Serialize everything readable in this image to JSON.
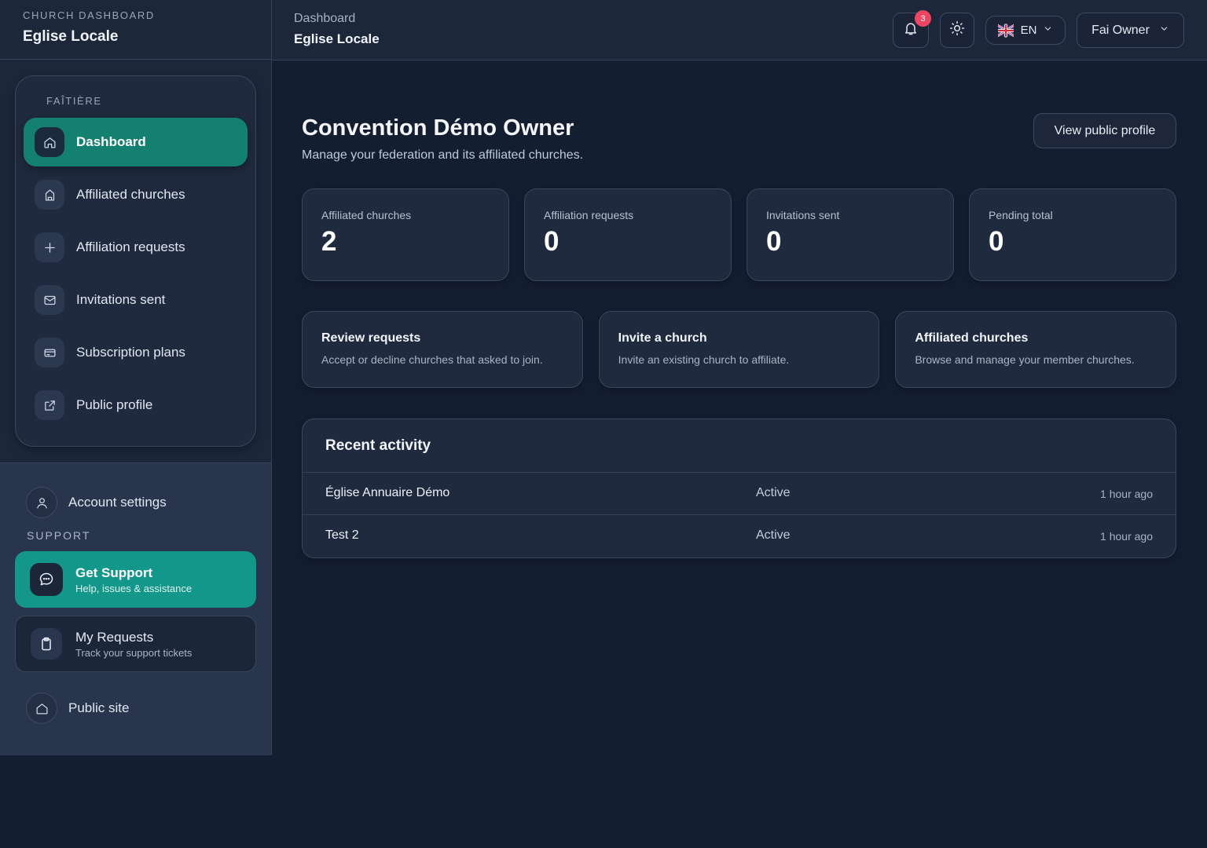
{
  "brand": {
    "kicker": "CHURCH DASHBOARD",
    "title": "Eglise Locale"
  },
  "nav": {
    "section": "FAÎTIÈRE",
    "items": [
      {
        "label": "Dashboard",
        "icon": "home-icon",
        "active": true
      },
      {
        "label": "Affiliated churches",
        "icon": "church-icon"
      },
      {
        "label": "Affiliation requests",
        "icon": "plus-icon"
      },
      {
        "label": "Invitations sent",
        "icon": "mail-icon"
      },
      {
        "label": "Subscription plans",
        "icon": "credit-card-icon"
      },
      {
        "label": "Public profile",
        "icon": "external-link-icon"
      }
    ]
  },
  "account": {
    "label": "Account settings",
    "icon": "user-icon"
  },
  "support": {
    "label": "SUPPORT",
    "get_support": {
      "title": "Get Support",
      "subtitle": "Help, issues & assistance",
      "icon": "chat-icon"
    },
    "my_requests": {
      "title": "My Requests",
      "subtitle": "Track your support tickets",
      "icon": "clipboard-icon"
    }
  },
  "public_site": {
    "label": "Public site",
    "icon": "home-icon"
  },
  "topbar": {
    "breadcrumb": "Dashboard",
    "subtitle": "Eglise Locale",
    "notifications_count": "3",
    "language": "EN",
    "user": "Fai Owner"
  },
  "page": {
    "title": "Convention Démo Owner",
    "subtitle": "Manage your federation and its affiliated churches.",
    "public_profile_button": "View public profile"
  },
  "stats": [
    {
      "label": "Affiliated churches",
      "value": "2"
    },
    {
      "label": "Affiliation requests",
      "value": "0"
    },
    {
      "label": "Invitations sent",
      "value": "0"
    },
    {
      "label": "Pending total",
      "value": "0"
    }
  ],
  "actions": [
    {
      "title": "Review requests",
      "desc": "Accept or decline churches that asked to join."
    },
    {
      "title": "Invite a church",
      "desc": "Invite an existing church to affiliate."
    },
    {
      "title": "Affiliated churches",
      "desc": "Browse and manage your member churches."
    }
  ],
  "activity": {
    "title": "Recent activity",
    "rows": [
      {
        "name": "Église Annuaire Démo",
        "status": "Active",
        "time": "1 hour ago"
      },
      {
        "name": "Test 2",
        "status": "Active",
        "time": "1 hour ago"
      }
    ]
  },
  "colors": {
    "accent": "#14806f",
    "support_accent": "#12978a",
    "badge": "#ef4563",
    "background": "#141e31"
  }
}
